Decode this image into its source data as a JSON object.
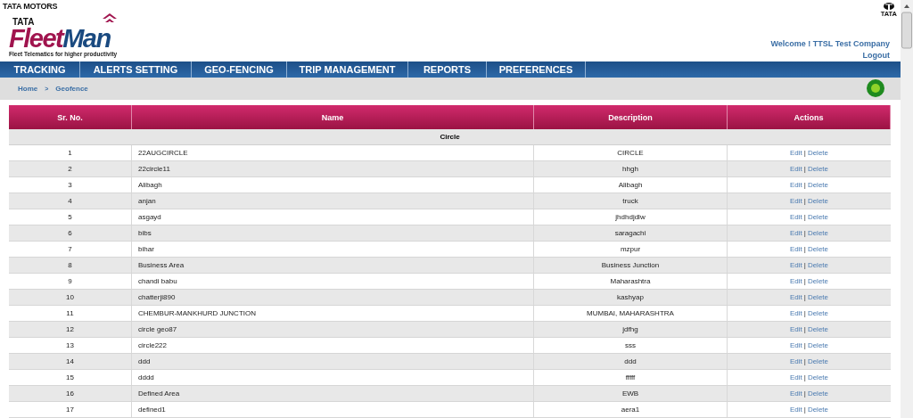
{
  "brand": {
    "company": "TATA MOTORS",
    "corner_logo": "TATA",
    "logo_top": "TATA",
    "logo_word_1": "Fleet",
    "logo_word_2": "Man",
    "tagline": "Fleet Telematics for higher productivity"
  },
  "user": {
    "welcome": "Welcome ! TTSL Test Company",
    "logout": "Logout"
  },
  "menu": [
    "TRACKING",
    "ALERTS SETTING",
    "GEO-FENCING",
    "TRIP MANAGEMENT",
    "REPORTS",
    "PREFERENCES"
  ],
  "breadcrumb": {
    "items": [
      "Home",
      "Geofence"
    ],
    "separator": ">"
  },
  "table": {
    "columns": [
      "Sr. No.",
      "Name",
      "Description",
      "Actions"
    ],
    "group": "Circle",
    "rows": [
      {
        "no": "1",
        "name": "22AUGCIRCLE",
        "description": "CIRCLE",
        "actions": [
          "Edit",
          "Delete"
        ],
        "sep": "|"
      },
      {
        "no": "2",
        "name": "22circle11",
        "description": "hhgh",
        "actions": [
          "Edit",
          "Delete"
        ],
        "sep": "|"
      },
      {
        "no": "3",
        "name": "Alibagh",
        "description": "Alibagh",
        "actions": [
          "Edit",
          "Delete"
        ],
        "sep": "|"
      },
      {
        "no": "4",
        "name": "anjan",
        "description": "truck",
        "actions": [
          "Edit",
          "Delete"
        ],
        "sep": "|"
      },
      {
        "no": "5",
        "name": "asgayd",
        "description": "jhdhdjdlw",
        "actions": [
          "Edit",
          "Delete"
        ],
        "sep": "|"
      },
      {
        "no": "6",
        "name": "bibs",
        "description": "saragachi",
        "actions": [
          "Edit",
          "Delete"
        ],
        "sep": "|"
      },
      {
        "no": "7",
        "name": "bihar",
        "description": "mzpur",
        "actions": [
          "Edit",
          "Delete"
        ],
        "sep": "|"
      },
      {
        "no": "8",
        "name": "Business Area",
        "description": "Business Junction",
        "actions": [
          "Edit",
          "Delete"
        ],
        "sep": "|"
      },
      {
        "no": "9",
        "name": "chandi babu",
        "description": "Maharashtra",
        "actions": [
          "Edit",
          "Delete"
        ],
        "sep": "|"
      },
      {
        "no": "10",
        "name": "chatterji890",
        "description": "kashyap",
        "actions": [
          "Edit",
          "Delete"
        ],
        "sep": "|"
      },
      {
        "no": "11",
        "name": "CHEMBUR-MANKHURD JUNCTION",
        "description": "MUMBAI, MAHARASHTRA",
        "actions": [
          "Edit",
          "Delete"
        ],
        "sep": "|"
      },
      {
        "no": "12",
        "name": "circle geo87",
        "description": "jdfhg",
        "actions": [
          "Edit",
          "Delete"
        ],
        "sep": "|"
      },
      {
        "no": "13",
        "name": "circle222",
        "description": "sss",
        "actions": [
          "Edit",
          "Delete"
        ],
        "sep": "|"
      },
      {
        "no": "14",
        "name": "ddd",
        "description": "ddd",
        "actions": [
          "Edit",
          "Delete"
        ],
        "sep": "|"
      },
      {
        "no": "15",
        "name": "dddd",
        "description": "fffff",
        "actions": [
          "Edit",
          "Delete"
        ],
        "sep": "|"
      },
      {
        "no": "16",
        "name": "Defined Area",
        "description": "EWB",
        "actions": [
          "Edit",
          "Delete"
        ],
        "sep": "|"
      },
      {
        "no": "17",
        "name": "defined1",
        "description": "aera1",
        "actions": [
          "Edit",
          "Delete"
        ],
        "sep": "|"
      }
    ]
  }
}
